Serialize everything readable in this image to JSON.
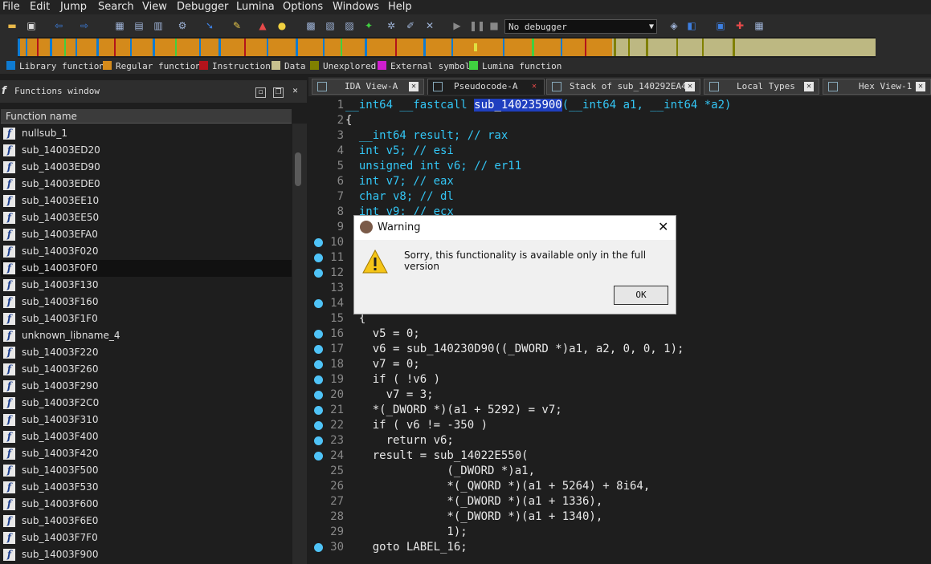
{
  "menu": [
    "File",
    "Edit",
    "Jump",
    "Search",
    "View",
    "Debugger",
    "Lumina",
    "Options",
    "Windows",
    "Help"
  ],
  "toolbar": {
    "debugger_select": "No debugger"
  },
  "legend": [
    {
      "label": "Library function",
      "color": "#0f7bd1"
    },
    {
      "label": "Regular function",
      "color": "#d48a1b"
    },
    {
      "label": "Instruction",
      "color": "#b3131b"
    },
    {
      "label": "Data",
      "color": "#c7c08e"
    },
    {
      "label": "Unexplored",
      "color": "#808000"
    },
    {
      "label": "External symbol",
      "color": "#d01ed0"
    },
    {
      "label": "Lumina function",
      "color": "#40d040"
    }
  ],
  "functions_window": {
    "title": "Functions window",
    "column": "Function name",
    "items": [
      "nullsub_1",
      "sub_14003ED20",
      "sub_14003ED90",
      "sub_14003EDE0",
      "sub_14003EE10",
      "sub_14003EE50",
      "sub_14003EFA0",
      "sub_14003F020",
      "sub_14003F0F0",
      "sub_14003F130",
      "sub_14003F160",
      "sub_14003F1F0",
      "unknown_libname_4",
      "sub_14003F220",
      "sub_14003F260",
      "sub_14003F290",
      "sub_14003F2C0",
      "sub_14003F310",
      "sub_14003F400",
      "sub_14003F420",
      "sub_14003F500",
      "sub_14003F530",
      "sub_14003F600",
      "sub_14003F6E0",
      "sub_14003F7F0",
      "sub_14003F900"
    ],
    "selected": "sub_14003F0F0"
  },
  "tabs": [
    {
      "label": "IDA View-A",
      "active": false
    },
    {
      "label": "Pseudocode-A",
      "active": true
    },
    {
      "label": "Stack of sub_140292EA4",
      "active": false
    },
    {
      "label": "Local Types",
      "active": false
    },
    {
      "label": "Hex View-1",
      "active": false
    }
  ],
  "code": {
    "line_numbers": [
      "1",
      "2",
      "3",
      "4",
      "5",
      "6",
      "7",
      "8",
      "9",
      "10",
      "11",
      "12",
      "13",
      "14",
      "15",
      "16",
      "17",
      "18",
      "19",
      "20",
      "21",
      "22",
      "23",
      "24",
      "25",
      "26",
      "27",
      "28",
      "29",
      "30"
    ],
    "line1": {
      "pre": "__int64 __fastcall ",
      "fname": "sub_140235900",
      "post": "(__int64 a1, __int64 *a2)"
    },
    "lines": [
      "{",
      "  __int64 result; // rax",
      "  int v5; // esi",
      "  unsigned int v6; // er11",
      "  int v7; // eax",
      "  char v8; // dl",
      "  int v9; // ecx",
      "",
      "",
      "",
      "",
      "",
      "",
      "  {",
      "    v5 = 0;",
      "    v6 = sub_140230D90((_DWORD *)a1, a2, 0, 0, 1);",
      "    v7 = 0;",
      "    if ( !v6 )",
      "      v7 = 3;",
      "    *(_DWORD *)(a1 + 5292) = v7;",
      "    if ( v6 != -350 )",
      "      return v6;",
      "    result = sub_14022E550(",
      "               (_DWORD *)a1,",
      "               *(_QWORD *)(a1 + 5264) + 8i64,",
      "               *(_DWORD *)(a1 + 1336),",
      "               *(_DWORD *)(a1 + 1340),",
      "               1);",
      "    goto LABEL_16;"
    ],
    "breakpoint_lines": [
      "10",
      "11",
      "12",
      "14",
      "16",
      "17",
      "18",
      "19",
      "20",
      "21",
      "22",
      "23",
      "24",
      "30"
    ]
  },
  "dialog": {
    "title": "Warning",
    "message": "Sorry, this functionality is available only in the full version",
    "ok_label": "OK"
  }
}
